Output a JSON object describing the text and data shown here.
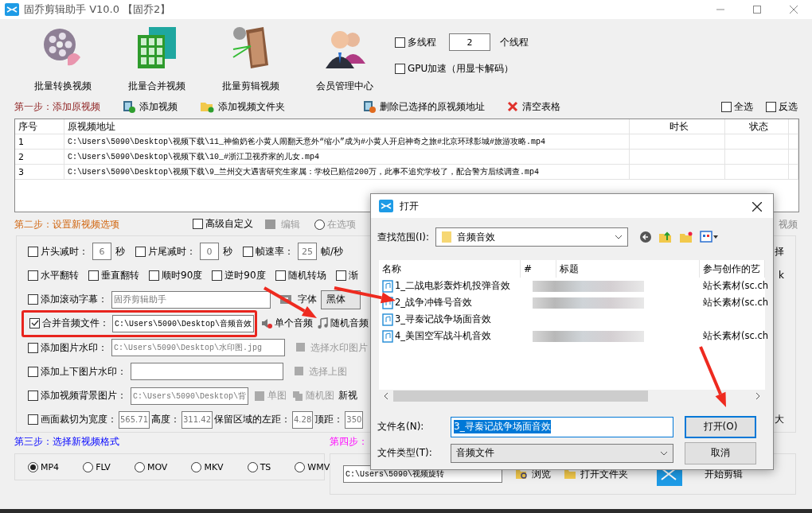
{
  "window": {
    "title": "固乔剪辑助手 V10.0 【固乔2】"
  },
  "toolbar": [
    {
      "kind": "convert",
      "label": "批量转换视频"
    },
    {
      "kind": "merge",
      "label": "批量合并视频"
    },
    {
      "kind": "cut",
      "label": "批量剪辑视频"
    },
    {
      "kind": "member",
      "label": "会员管理中心"
    }
  ],
  "threading": {
    "multi": {
      "label": "多线程",
      "checked": false
    },
    "count": "2",
    "unit": "个线程",
    "gpu": {
      "label": "GPU加速（用显卡解码）",
      "checked": false
    }
  },
  "step1": {
    "title": "第一步：添加原视频",
    "actions": [
      {
        "kind": "add-video",
        "label": "添加视频"
      },
      {
        "kind": "add-folder",
        "label": "添加视频文件夹"
      },
      {
        "kind": "delete",
        "label": "删除已选择的原视频地址"
      },
      {
        "kind": "clear",
        "label": "清空表格"
      }
    ],
    "select_all": {
      "label": "全选",
      "checked": false
    },
    "invert": {
      "label": "反选",
      "checked": false
    }
  },
  "table": {
    "columns": [
      "序号",
      "原视频地址",
      "时长",
      "状态"
    ],
    "rows": [
      {
        "index": "1",
        "path": "C:\\Users\\5090\\Desktop\\视频下载\\11_神偷奶爸小黄人闹翻天意外“缩小”成为#小黄人开启神奇之旅#北京环球影城#旅游攻略.mp4"
      },
      {
        "index": "2",
        "path": "C:\\Users\\5090\\Desktop\\视频下载\\10_#浙江卫视乔家的儿女.mp4"
      },
      {
        "index": "3",
        "path": "C:\\Users\\5090\\Desktop\\视频下载\\9_兰州交大遇害研究生家属：学校已赔偿200万，此事不追究学校了，配合警方后续调查.mp4"
      }
    ]
  },
  "step2": {
    "title": "第二步：设置新视频选项",
    "advanced": {
      "label": "高级自定义",
      "checked": false
    },
    "edit": "编辑",
    "position": {
      "label": "在选项",
      "selected": false
    },
    "tail": "视频",
    "trim": {
      "items": [
        {
          "label": "片头减时：",
          "checked": false,
          "value": "6",
          "unit": "秒"
        },
        {
          "label": "片尾减时：",
          "checked": false,
          "value": "0",
          "unit": "秒"
        },
        {
          "label": "帧速率：",
          "checked": false,
          "value": "25",
          "unit": "帧/秒"
        }
      ],
      "tail": "择"
    },
    "transforms": {
      "items": [
        {
          "label": "水平翻转",
          "checked": false
        },
        {
          "label": "垂直翻转",
          "checked": false
        },
        {
          "label": "顺时90度",
          "checked": false
        },
        {
          "label": "逆时90度",
          "checked": false
        },
        {
          "label": "随机转场",
          "checked": false
        },
        {
          "label": "渐",
          "checked": false
        }
      ],
      "tail": "k"
    },
    "subtitle": {
      "label": "添加滚动字幕：",
      "checked": false,
      "value": "固乔剪辑助手",
      "font_label": "字体",
      "font_value": "黑体"
    },
    "audio": {
      "label": "合并音频文件：",
      "checked": true,
      "highlighted": true,
      "value": "C:\\Users\\5090\\Desktop\\音频音效",
      "actions": [
        {
          "kind": "single",
          "label": "单个音频"
        },
        {
          "kind": "random",
          "label": "随机音频"
        }
      ]
    },
    "image_watermark": {
      "label": "添加图片水印：",
      "checked": false,
      "value": "C:\\Users\\5090\\Desktop\\水印图.jpg",
      "action": "选择水印图片"
    },
    "top_bottom_watermark": {
      "label": "添加上下图片水印：",
      "checked": false,
      "action": "选择上图"
    },
    "background": {
      "label": "添加视频背景图片：",
      "checked": false,
      "value": "C:\\Users\\5090\\Desktop\\背",
      "actions": [
        {
          "kind": "single",
          "label": "单图"
        },
        {
          "kind": "random",
          "label": "随机图"
        }
      ],
      "trailing": "新视"
    },
    "crop": {
      "label": "画面裁切为宽度：",
      "checked": false,
      "fields": [
        {
          "value": "565.71"
        },
        {
          "label": "高度：",
          "value": "311.42"
        },
        {
          "label": "保留区域的左距：",
          "value": "4.28"
        },
        {
          "label": "顶距：",
          "value": "350"
        }
      ],
      "tail": "大"
    }
  },
  "step3": {
    "title": "第三步：选择新视频格式",
    "formats": [
      {
        "label": "MP4",
        "selected": true
      },
      {
        "label": "FLV",
        "selected": false
      },
      {
        "label": "MOV",
        "selected": false
      },
      {
        "label": "MKV",
        "selected": false
      },
      {
        "label": "TS",
        "selected": false
      },
      {
        "label": "WMV",
        "selected": false
      }
    ]
  },
  "step4": {
    "title": "第四步：",
    "output_path": "C:\\Users\\5090\\视频旋转",
    "browse": "浏览",
    "open_folder": "打开文件夹",
    "start": "开始剪辑"
  },
  "dialog": {
    "title": "打开",
    "look_in_label": "查找范围(I):",
    "look_in": "音频音效",
    "columns": [
      "名称",
      "#",
      "标题",
      "参与创作的艺"
    ],
    "files": [
      {
        "name": "1_二战电影轰炸机投弹音效",
        "blurred": true,
        "artist": "站长素材(sc.ch"
      },
      {
        "name": "2_战争冲锋号音效",
        "blurred": true,
        "artist": "站长素材(sc.ch"
      },
      {
        "name": "3_寻秦记战争场面音效",
        "blurred": false
      },
      {
        "name": "4_美国空军战斗机音效",
        "blurred": true,
        "artist": "站长素材(sc.ch"
      }
    ],
    "filename_label": "文件名(N):",
    "filename": "3_寻秦记战争场面音效",
    "filetype_label": "文件类型(T):",
    "filetype": "音频文件",
    "buttons": [
      {
        "label": "打开(O)",
        "default": true
      },
      {
        "label": "取消",
        "default": false
      }
    ]
  }
}
